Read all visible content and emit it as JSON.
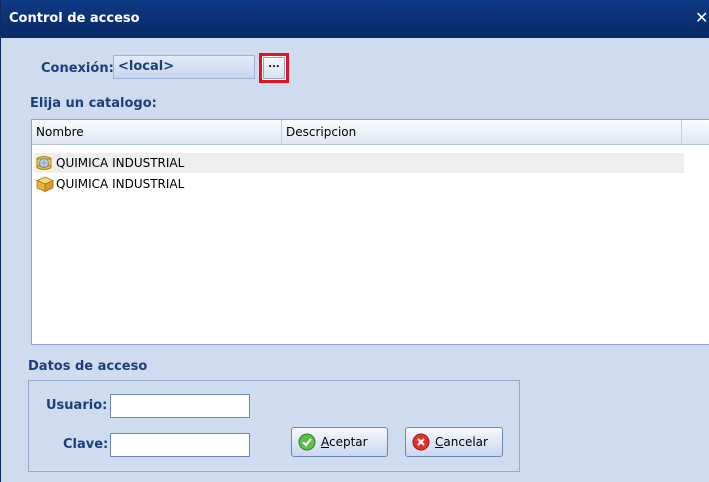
{
  "window": {
    "title": "Control de acceso",
    "close_glyph": "✕"
  },
  "connection": {
    "label": "Conexión:",
    "value": "<local>",
    "browse_label": "..."
  },
  "catalog": {
    "label": "Elija un catalogo:",
    "columns": [
      "Nombre",
      "Descripcion"
    ],
    "rows": [
      {
        "name": "QUIMICA INDUSTRIAL",
        "description": "",
        "icon": "database-globe-icon",
        "selected": true
      },
      {
        "name": "QUIMICA INDUSTRIAL",
        "description": "",
        "icon": "database-box-icon",
        "selected": false
      }
    ]
  },
  "access": {
    "section_label": "Datos de acceso",
    "user_label": "Usuario:",
    "user_value": "",
    "password_label": "Clave:",
    "password_value": "",
    "accept_label_first": "A",
    "accept_label_rest": "ceptar",
    "cancel_label_first": "C",
    "cancel_label_rest": "ancelar"
  },
  "colors": {
    "accent": "#1b3f7a",
    "highlight": "#e0131f",
    "titlebar": "#0b2f72",
    "background": "#cfdcef"
  }
}
